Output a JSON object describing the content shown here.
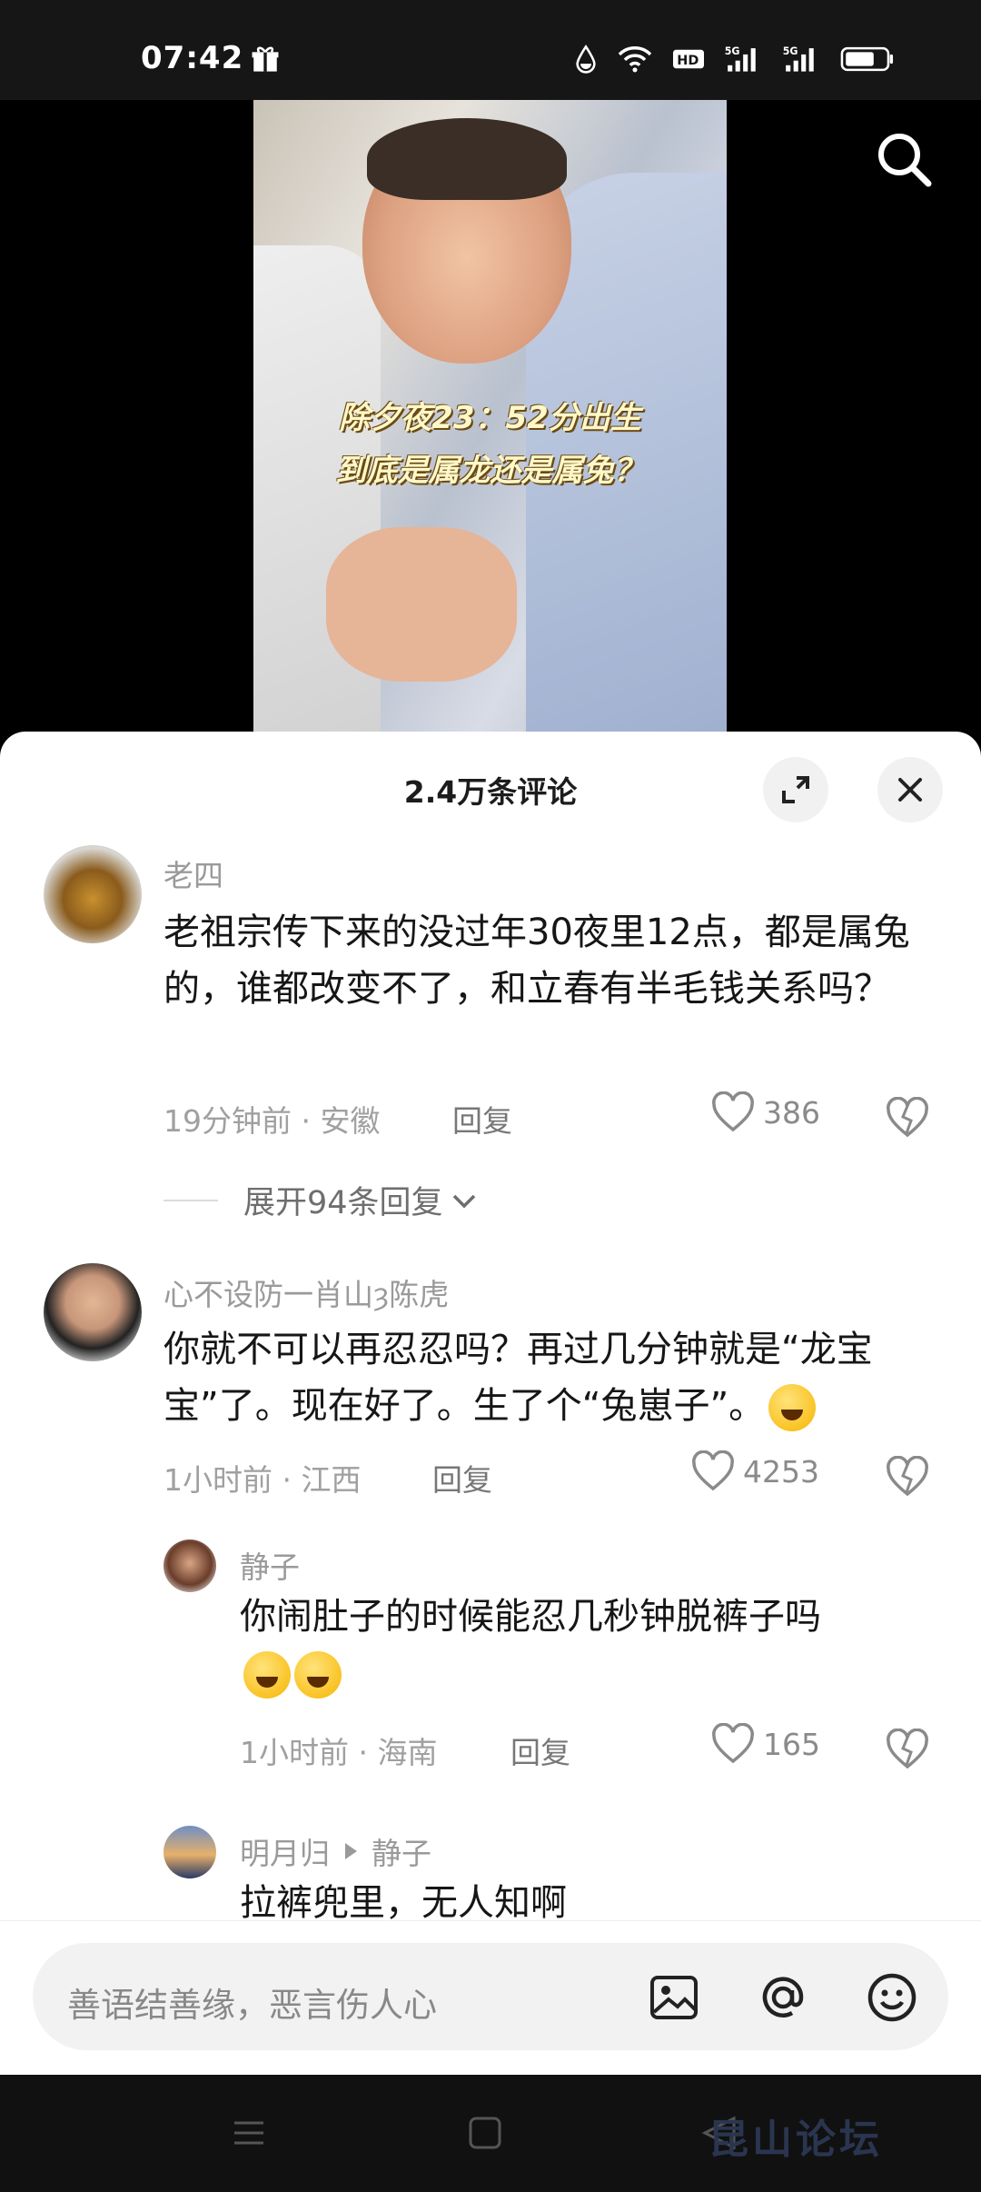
{
  "status": {
    "time": "07:42",
    "icons": [
      "gift-icon",
      "drop-icon",
      "wifi-icon",
      "hd-icon",
      "signal-5g-icon",
      "signal-5g-icon",
      "battery-icon"
    ]
  },
  "video": {
    "caption_line1": "除夕夜23：52分出生",
    "caption_line2": "到底是属龙还是属兔？"
  },
  "comments_panel": {
    "title": "2.4万条评论",
    "comments": [
      {
        "user": "老四",
        "text": "老祖宗传下来的没过年30夜里12点，都是属兔的，谁都改变不了，和立春有半毛钱关系吗？",
        "time_location": "19分钟前 · 安徽",
        "reply": "回复",
        "likes": "386",
        "expand": "展开94条回复"
      },
      {
        "user": "心不设防一肖山ȝ陈虎",
        "text": "你就不可以再忍忍吗？再过几分钟就是“龙宝宝”了。现在好了。生了个“兔崽子”。",
        "time_location": "1小时前 · 江西",
        "reply": "回复",
        "likes": "4253",
        "sub_replies": [
          {
            "user": "静子",
            "text": "你闹肚子的时候能忍几秒钟脱裤子吗",
            "time_location": "1小时前 · 海南",
            "reply": "回复",
            "likes": "165"
          },
          {
            "user": "明月归",
            "reply_to": "静子",
            "text": "拉裤兜里，无人知啊"
          }
        ]
      }
    ]
  },
  "input": {
    "placeholder": "善语结善缘，恶言伤人心"
  },
  "watermark": "昆山论坛"
}
